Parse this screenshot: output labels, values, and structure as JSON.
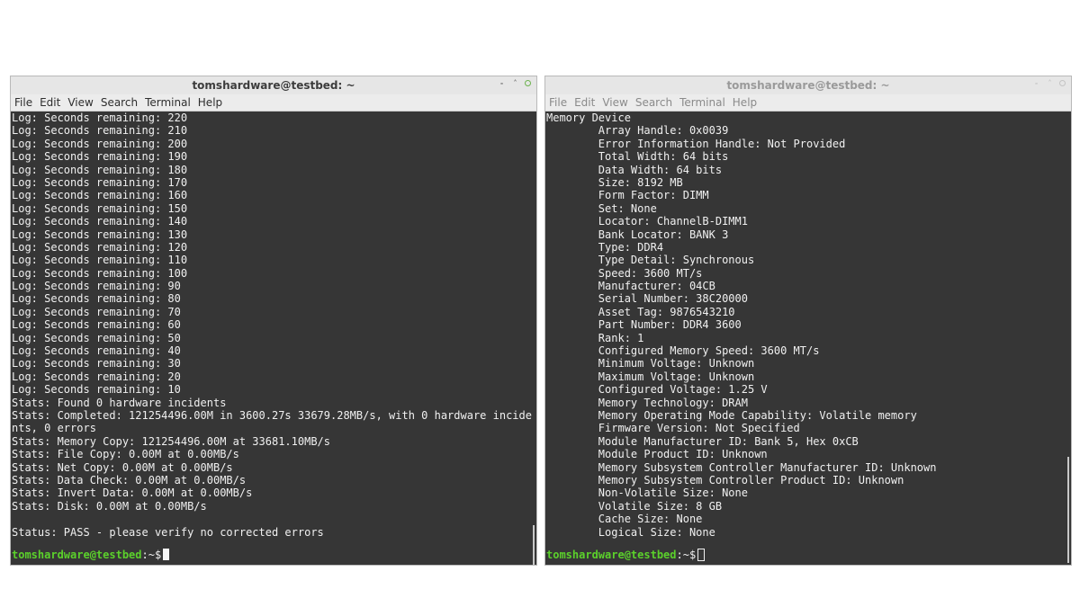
{
  "left": {
    "title": "tomshardware@testbed: ~",
    "menu": [
      "File",
      "Edit",
      "View",
      "Search",
      "Terminal",
      "Help"
    ],
    "lines": [
      "Log: Seconds remaining: 220",
      "Log: Seconds remaining: 210",
      "Log: Seconds remaining: 200",
      "Log: Seconds remaining: 190",
      "Log: Seconds remaining: 180",
      "Log: Seconds remaining: 170",
      "Log: Seconds remaining: 160",
      "Log: Seconds remaining: 150",
      "Log: Seconds remaining: 140",
      "Log: Seconds remaining: 130",
      "Log: Seconds remaining: 120",
      "Log: Seconds remaining: 110",
      "Log: Seconds remaining: 100",
      "Log: Seconds remaining: 90",
      "Log: Seconds remaining: 80",
      "Log: Seconds remaining: 70",
      "Log: Seconds remaining: 60",
      "Log: Seconds remaining: 50",
      "Log: Seconds remaining: 40",
      "Log: Seconds remaining: 30",
      "Log: Seconds remaining: 20",
      "Log: Seconds remaining: 10",
      "Stats: Found 0 hardware incidents",
      "Stats: Completed: 121254496.00M in 3600.27s 33679.28MB/s, with 0 hardware incide",
      "nts, 0 errors",
      "Stats: Memory Copy: 121254496.00M at 33681.10MB/s",
      "Stats: File Copy: 0.00M at 0.00MB/s",
      "Stats: Net Copy: 0.00M at 0.00MB/s",
      "Stats: Data Check: 0.00M at 0.00MB/s",
      "Stats: Invert Data: 0.00M at 0.00MB/s",
      "Stats: Disk: 0.00M at 0.00MB/s",
      "",
      "Status: PASS - please verify no corrected errors"
    ],
    "prompt_user": "tomshardware@testbed",
    "prompt_path": ":~$"
  },
  "right": {
    "title": "tomshardware@testbed: ~",
    "menu": [
      "File",
      "Edit",
      "View",
      "Search",
      "Terminal",
      "Help"
    ],
    "lines": [
      "Memory Device",
      "        Array Handle: 0x0039",
      "        Error Information Handle: Not Provided",
      "        Total Width: 64 bits",
      "        Data Width: 64 bits",
      "        Size: 8192 MB",
      "        Form Factor: DIMM",
      "        Set: None",
      "        Locator: ChannelB-DIMM1",
      "        Bank Locator: BANK 3",
      "        Type: DDR4",
      "        Type Detail: Synchronous",
      "        Speed: 3600 MT/s",
      "        Manufacturer: 04CB",
      "        Serial Number: 38C20000",
      "        Asset Tag: 9876543210",
      "        Part Number: DDR4 3600",
      "        Rank: 1",
      "        Configured Memory Speed: 3600 MT/s",
      "        Minimum Voltage: Unknown",
      "        Maximum Voltage: Unknown",
      "        Configured Voltage: 1.25 V",
      "        Memory Technology: DRAM",
      "        Memory Operating Mode Capability: Volatile memory",
      "        Firmware Version: Not Specified",
      "        Module Manufacturer ID: Bank 5, Hex 0xCB",
      "        Module Product ID: Unknown",
      "        Memory Subsystem Controller Manufacturer ID: Unknown",
      "        Memory Subsystem Controller Product ID: Unknown",
      "        Non-Volatile Size: None",
      "        Volatile Size: 8 GB",
      "        Cache Size: None",
      "        Logical Size: None"
    ],
    "prompt_user": "tomshardware@testbed",
    "prompt_path": ":~$"
  }
}
